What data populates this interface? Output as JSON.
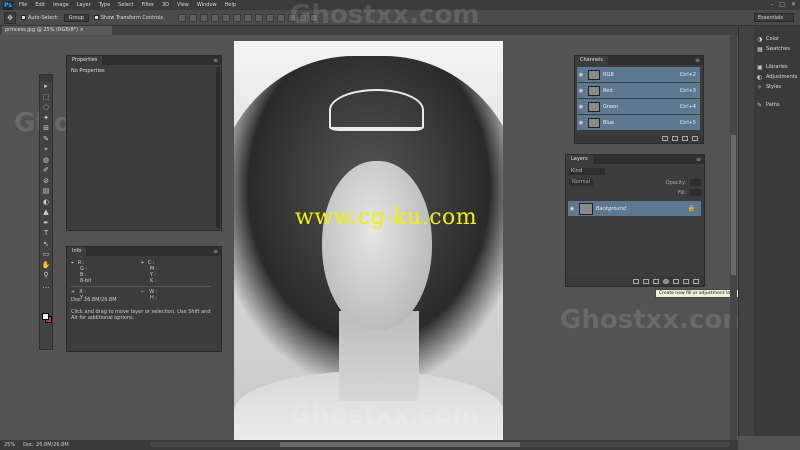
{
  "menu": [
    "File",
    "Edit",
    "Image",
    "Layer",
    "Type",
    "Select",
    "Filter",
    "3D",
    "View",
    "Window",
    "Help"
  ],
  "window_controls": [
    "–",
    "□",
    "✕"
  ],
  "options": {
    "auto_select_label": "Auto-Select:",
    "auto_select_value": "Group",
    "transform_controls_label": "Show Transform Controls",
    "workspace": "Essentials"
  },
  "document_tab": "princess.jpg @ 25% (RGB/8*) ×",
  "properties": {
    "tab": "Properties",
    "text": "No Properties"
  },
  "info": {
    "tab": "Info",
    "rows_left": [
      [
        "R :",
        ""
      ],
      [
        "G :",
        ""
      ],
      [
        "B :",
        ""
      ],
      [
        "8-bit",
        ""
      ]
    ],
    "rows_right": [
      [
        "C :",
        ""
      ],
      [
        "M :",
        ""
      ],
      [
        "Y :",
        ""
      ],
      [
        "K :",
        ""
      ]
    ],
    "xy_left": [
      [
        "X :",
        ""
      ],
      [
        "Y :",
        ""
      ]
    ],
    "wh_right": [
      [
        "W :",
        ""
      ],
      [
        "H :",
        ""
      ]
    ],
    "doc": "Doc: 26.8M/26.8M",
    "hint": "Click and drag to move layer or selection. Use Shift and Alt for additional options."
  },
  "channels": {
    "tab": "Channels",
    "rows": [
      {
        "name": "RGB",
        "key": "Ctrl+2"
      },
      {
        "name": "Red",
        "key": "Ctrl+3"
      },
      {
        "name": "Green",
        "key": "Ctrl+4"
      },
      {
        "name": "Blue",
        "key": "Ctrl+5"
      }
    ]
  },
  "layers": {
    "tab": "Layers",
    "filter": "Kind",
    "blend_mode": "Normal",
    "opacity_label": "Opacity:",
    "fill_label": "Fill:",
    "layer_name": "Background"
  },
  "tooltip": "Create new fill or adjustment layer",
  "dock": {
    "group1": [
      "Color",
      "Swatches"
    ],
    "group2": [
      "Libraries",
      "Adjustments",
      "Styles"
    ],
    "group3": [
      "Paths"
    ]
  },
  "canvas_watermark": "www.cg-ku.com",
  "ghost_watermark": "Ghostxx.com",
  "status": {
    "zoom": "25%",
    "doc": "Doc: 26.8M/26.8M"
  },
  "tools": [
    "▸",
    "⬚",
    "◌",
    "✦",
    "⊞",
    "✎",
    "⌖",
    "◍",
    "✐",
    "⊘",
    "▤",
    "◐",
    "▲",
    "✒",
    "T",
    "↖",
    "▭",
    "✋",
    "⚲",
    "…"
  ]
}
